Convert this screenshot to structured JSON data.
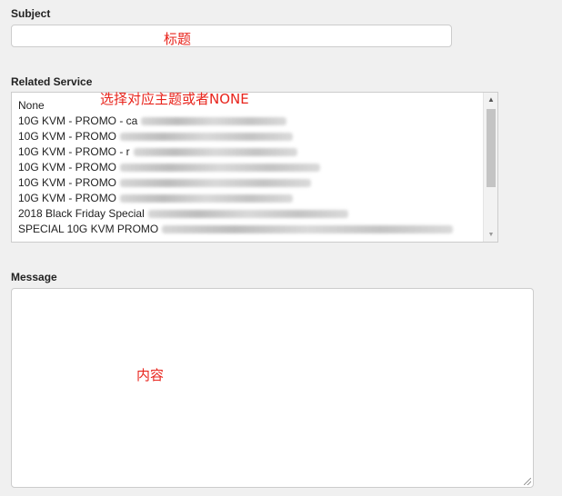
{
  "form": {
    "subject_label": "Subject",
    "subject_value": "",
    "related_label": "Related Service",
    "message_label": "Message",
    "message_value": ""
  },
  "annotations": {
    "subject": "标题",
    "related": "选择对应主题或者NONE",
    "message": "内容"
  },
  "services": [
    "None",
    "10G KVM - PROMO - ca",
    "10G KVM - PROMO",
    "10G KVM - PROMO - r",
    "10G KVM - PROMO",
    "10G KVM - PROMO",
    "10G KVM - PROMO",
    "2018 Black Friday Special",
    "SPECIAL 10G KVM PROMO"
  ],
  "icons": {
    "scroll_up": "chevron-up-icon",
    "scroll_down": "chevron-down-icon",
    "resize": "resize-grip-icon"
  },
  "colors": {
    "annotation": "#e8241c",
    "background": "#f0f0f0"
  }
}
